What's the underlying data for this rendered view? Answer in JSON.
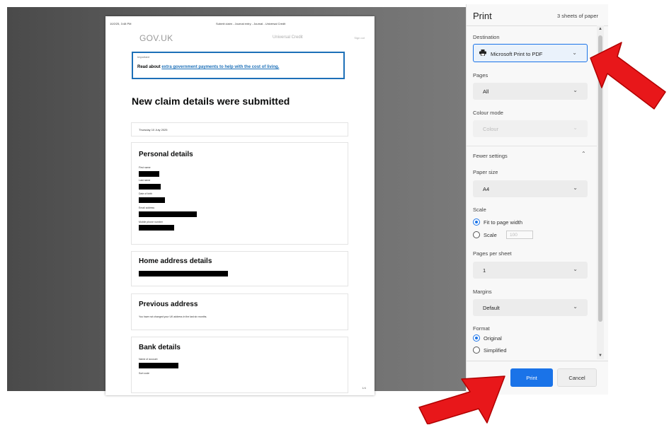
{
  "preview": {
    "header_meta_left": "10/2/25, 3:48 PM",
    "header_meta_center": "Submit claim - Journal entry - Journal - Universal Credit",
    "logo": "GOV.UK",
    "service_name": "Universal Credit",
    "sign_out": "Sign out",
    "important_label": "Important",
    "important_text": "Read about ",
    "important_link": "extra government payments to help with the cost of living.",
    "page_title": "New claim details were submitted",
    "date": "Thursday 10 July 2025",
    "personal": {
      "heading": "Personal details",
      "fields": [
        "First name",
        "Last name",
        "Date of birth",
        "Email address",
        "Mobile phone number"
      ]
    },
    "home": {
      "heading": "Home address details"
    },
    "previous": {
      "heading": "Previous address",
      "text": "You have not changed your UK address in the last six months."
    },
    "bank": {
      "heading": "Bank details",
      "fields": [
        "Name of account",
        "Sort code"
      ]
    },
    "page_number": "1/4"
  },
  "dialog": {
    "title": "Print",
    "sheets": "3 sheets of paper",
    "destination_label": "Destination",
    "destination_value": "Microsoft Print to PDF",
    "pages_label": "Pages",
    "pages_value": "All",
    "colour_label": "Colour mode",
    "colour_value": "Colour",
    "fewer_settings": "Fewer settings",
    "paper_size_label": "Paper size",
    "paper_size_value": "A4",
    "scale_label": "Scale",
    "scale_fit": "Fit to page width",
    "scale_custom": "Scale",
    "scale_value": "100",
    "pages_per_sheet_label": "Pages per sheet",
    "pages_per_sheet_value": "1",
    "margins_label": "Margins",
    "margins_value": "Default",
    "format_label": "Format",
    "format_original": "Original",
    "format_simplified": "Simplified",
    "print_button": "Print",
    "cancel_button": "Cancel"
  },
  "colors": {
    "accent": "#1a73e8",
    "govuk_link": "#1d70b8",
    "arrow": "#e8171a"
  }
}
